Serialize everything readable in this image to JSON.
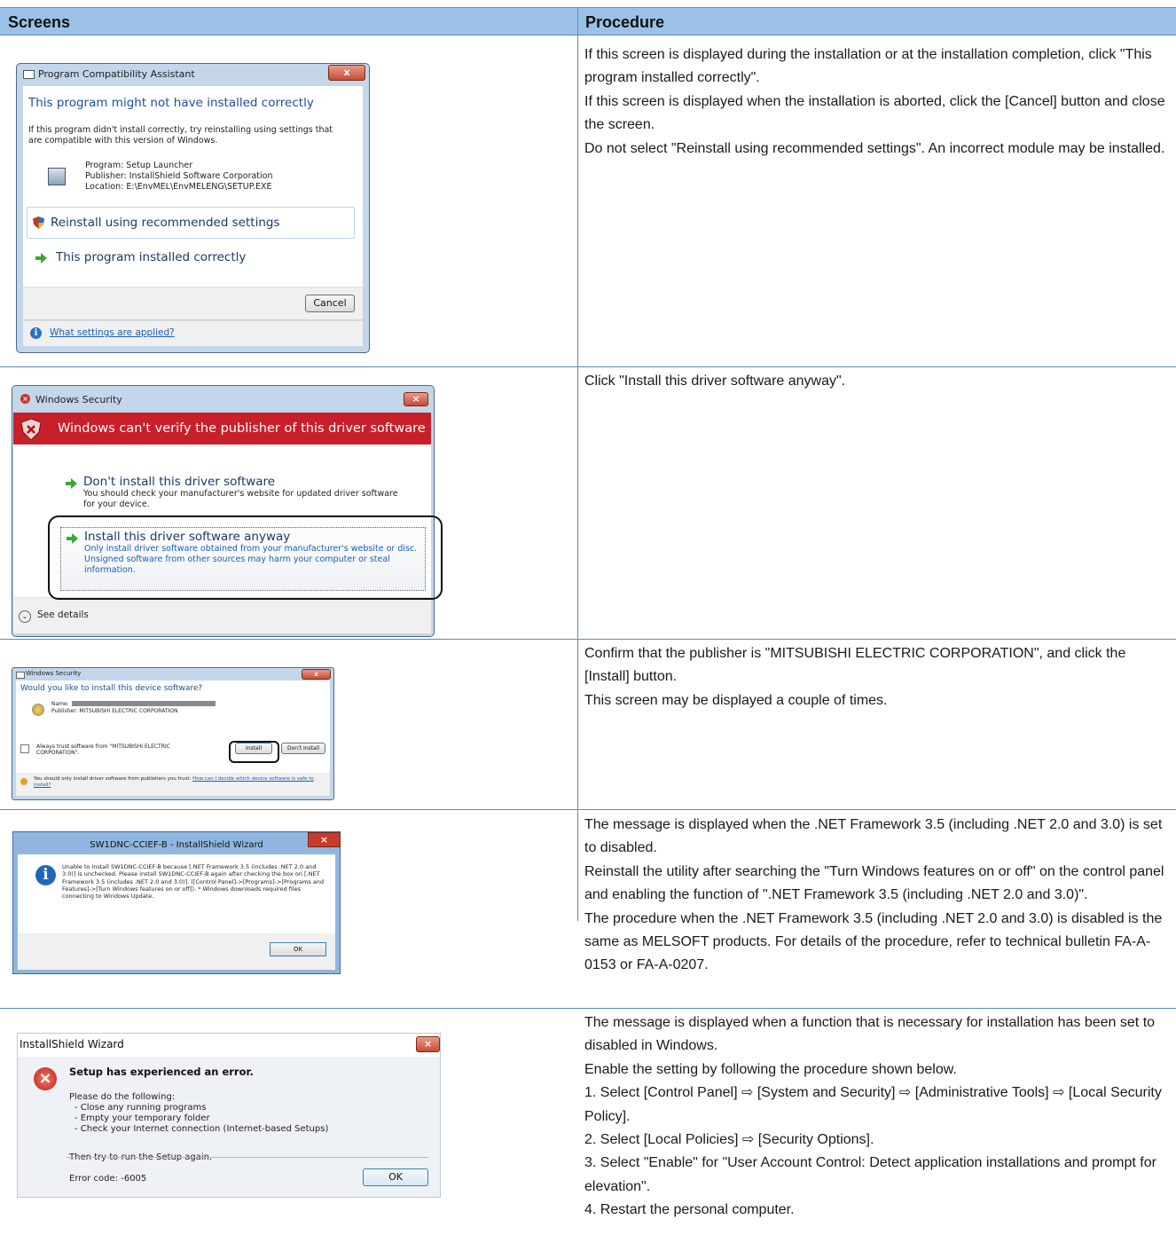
{
  "header": {
    "screens": "Screens",
    "procedure": "Procedure"
  },
  "rows": [
    {
      "procedure": [
        "If this screen is displayed during the installation or at the installation completion, click \"This program installed correctly\".",
        "If this screen is displayed when the installation is aborted, click the [Cancel] button and close the screen.",
        "Do not select \"Reinstall using recommended settings\". An incorrect module may be installed."
      ]
    },
    {
      "procedure": [
        "Click \"Install this driver software anyway\"."
      ]
    },
    {
      "procedure": [
        "Confirm that the publisher is \"MITSUBISHI ELECTRIC CORPORATION\", and click the [Install] button.",
        "This screen may be displayed a couple of times."
      ]
    },
    {
      "procedure": [
        "The message is displayed when the .NET Framework 3.5 (including .NET 2.0 and 3.0) is set to disabled.",
        "Reinstall the utility after searching the \"Turn Windows features on or off\" on the control panel and enabling the function of \".NET Framework 3.5 (including .NET 2.0 and 3.0)\".",
        "The procedure when the .NET Framework 3.5 (including .NET 2.0 and 3.0) is disabled is the same as MELSOFT products. For details of the procedure, refer to technical bulletin FA-A-0153 or FA-A-0207."
      ]
    },
    {
      "procedure": [
        "The message is displayed when a function that is necessary for installation has been set to disabled in Windows.",
        "Enable the setting by following the procedure shown below.",
        "1. Select [Control Panel] ⇨ [System and Security] ⇨ [Administrative Tools] ⇨ [Local Security Policy].",
        "2. Select [Local Policies] ⇨ [Security Options].",
        "3. Select \"Enable\" for \"User Account Control: Detect application installations and prompt for elevation\".",
        "4. Restart the personal computer."
      ]
    }
  ],
  "dialog1": {
    "title": "Program Compatibility Assistant",
    "close": "x",
    "heading": "This program might not have installed correctly",
    "body": "If this program didn't install correctly, try reinstalling using settings that are compatible with this version of Windows.",
    "program": "Program: Setup Launcher",
    "publisher": "Publisher: InstallShield Software Corporation",
    "location": "Location: E:\\EnvMEL\\EnvMELENG\\SETUP.EXE",
    "opt_reinstall": "Reinstall using recommended settings",
    "opt_correct": "This program installed correctly",
    "cancel": "Cancel",
    "help_link": "What settings are applied?"
  },
  "dialog2": {
    "title": "Windows Security",
    "heading": "Windows can't verify the publisher of this driver software",
    "opt1_title": "Don't install this driver software",
    "opt1_desc": "You should check your manufacturer's website for updated driver software for your device.",
    "opt2_title": "Install this driver software anyway",
    "opt2_desc": "Only install driver software obtained from your manufacturer's website or disc. Unsigned software from other sources may harm your computer or steal information.",
    "details": "See details"
  },
  "dialog3": {
    "title": "Windows Security",
    "heading": "Would you like to install this device software?",
    "name_label": "Name:",
    "publisher": "Publisher: MITSUBISHI ELECTRIC CORPORATION",
    "always_trust": "Always trust software from \"MITSUBISHI ELECTRIC CORPORATION\".",
    "install": "Install",
    "dont_install": "Don't Install",
    "footer": "You should only install driver software from publishers you trust.",
    "footer_link": "How can I decide which device software is safe to install?"
  },
  "dialog4": {
    "title": "SW1DNC-CCIEF-B - InstallShield Wizard",
    "message": "Unable to install SW1DNC-CCIEF-B because [.NET Framework 3.5 (includes .NET 2.0 and 3.0)] is unchecked. Please install SW1DNC-CCIEF-B again after checking the box on [.NET Framework 3.5 (includes .NET 2.0 and 3.0)]. ([Control Panel]->[Programs]->[Programs and Features]->[Turn Windows features on or off]). * Windows downloads required files connecting to Windows Update.",
    "ok": "OK"
  },
  "dialog5": {
    "title": "InstallShield Wizard",
    "heading": "Setup has experienced an error.",
    "intro": "Please do the following:",
    "items": [
      "- Close any running programs",
      "- Empty your temporary folder",
      "- Check your Internet connection (Internet-based Setups)"
    ],
    "retry": "Then try to run the Setup again.",
    "error_code": "Error code: -6005",
    "ok": "OK"
  },
  "colors": {
    "header_bg": "#9bc2e6",
    "grid": "#5b8ac2",
    "red_banner": "#c8202a"
  }
}
